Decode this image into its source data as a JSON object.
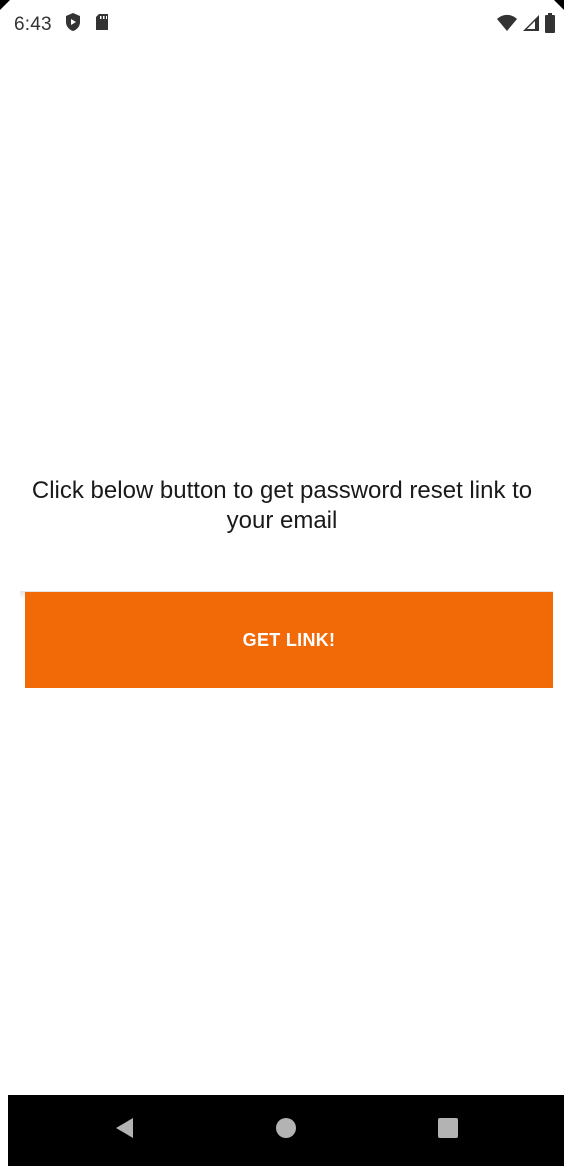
{
  "status_bar": {
    "time": "6:43",
    "left_icons": [
      "shield-icon",
      "sd-card-icon"
    ],
    "right_icons": [
      "wifi-icon",
      "signal-icon",
      "battery-icon"
    ]
  },
  "main": {
    "instruction_text": "Click below button to get password reset link to your email",
    "button_label": "GET LINK!",
    "accent_color": "#f26a07"
  },
  "nav_bar": {
    "buttons": [
      "back-icon",
      "home-icon",
      "recents-icon"
    ]
  }
}
